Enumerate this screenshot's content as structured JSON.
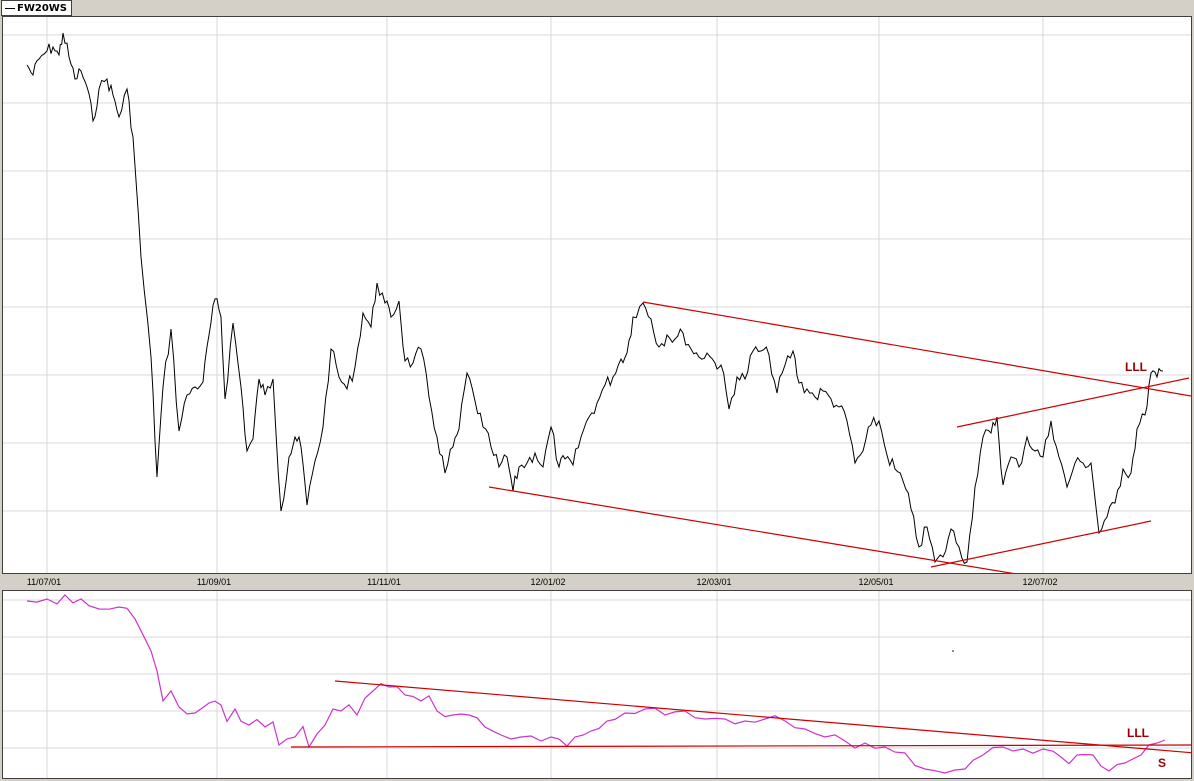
{
  "legend": {
    "series_label": "FW20WS"
  },
  "colors": {
    "price": "#000000",
    "indicator": "#cc33cc",
    "trendline": "#cc0000",
    "grid": "#d8d8d8",
    "annotation": "#990000"
  },
  "chart_data": [
    {
      "type": "line",
      "title": "",
      "series": [
        {
          "name": "FW20WS",
          "x": [
            "11/07/01",
            "11/08/01",
            "11/09/01",
            "11/10/01",
            "11/11/01",
            "11/12/01",
            "12/01/02",
            "12/02/02",
            "12/03/01",
            "12/04/01",
            "12/05/01",
            "12/06/01",
            "12/07/02",
            "12/08/01"
          ],
          "y": [
            1450,
            1080,
            1240,
            960,
            1290,
            1090,
            1010,
            1260,
            1120,
            1080,
            1000,
            990,
            1060,
            1100
          ]
        }
      ],
      "x_tick_labels": [
        "11/07/01",
        "11/09/01",
        "11/11/01",
        "12/01/02",
        "12/03/01",
        "12/05/01",
        "12/07/02"
      ],
      "annotations": [
        {
          "text": "LLL"
        }
      ],
      "trendlines": 4,
      "grid": true,
      "legend_position": "top-left"
    },
    {
      "type": "line",
      "title": "",
      "series": [
        {
          "values_trend": "indicator"
        }
      ],
      "annotations": [
        {
          "text": "LLL"
        },
        {
          "text": "S"
        }
      ],
      "trendlines": 2,
      "grid": true
    }
  ]
}
